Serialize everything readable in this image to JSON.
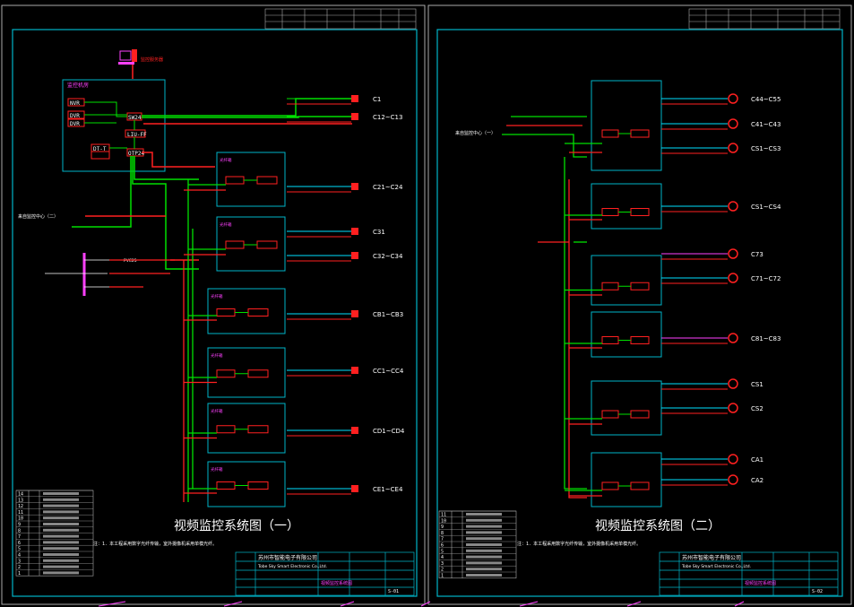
{
  "sheet1": {
    "title": "视频监控系统图（一）",
    "note": "注：1．本工程采用数字光纤传输，室外摄像机采用单模光纤。",
    "company_cn": "苏州市智能电子有限公司",
    "company_en": "Tobe Sky Smart Electronic Co.,Ltd.",
    "drawing_name": "视频监控系统图",
    "drawing_no": "S-01",
    "server_label": "监控服务器",
    "center_room": "监控机房",
    "center_items": [
      "NVR",
      "DVR",
      "DVR",
      "SW24",
      "LIU-FF",
      "DT-T",
      "OTP24"
    ],
    "cabinet_label": "光纤箱",
    "source_label": "来自监控中心（二）",
    "wall_label": "PVC25",
    "cam_groups": [
      {
        "id": "A",
        "labels": [
          "C1"
        ]
      },
      {
        "id": "B",
        "labels": [
          "C12~C13"
        ]
      },
      {
        "id": "C",
        "labels": [
          "C21~C24"
        ]
      },
      {
        "id": "D",
        "labels": [
          "C31"
        ]
      },
      {
        "id": "E",
        "labels": [
          "C32~C34"
        ]
      },
      {
        "id": "F",
        "labels": [
          "CB1~CB3"
        ]
      },
      {
        "id": "G",
        "labels": [
          "CC1~CC4"
        ]
      },
      {
        "id": "H",
        "labels": [
          "CD1~CD4"
        ]
      },
      {
        "id": "I",
        "labels": [
          "CE1~CE4"
        ]
      }
    ],
    "legend_rows": [
      "14",
      "13",
      "12",
      "11",
      "10",
      "9",
      "8",
      "7",
      "6",
      "5",
      "4",
      "3",
      "2",
      "1"
    ]
  },
  "sheet2": {
    "title": "视频监控系统图（二）",
    "note": "注：1．本工程采用数字光纤传输，室外摄像机采用单模光纤。",
    "company_cn": "苏州市智能电子有限公司",
    "company_en": "Tobe Sky Smart Electronic Co.,Ltd.",
    "drawing_name": "视频监控系统图",
    "drawing_no": "S-02",
    "source_label": "来自监控中心（一）",
    "cam_labels": [
      "C44~C55",
      "C41~C43",
      "CS1~CS3",
      "CS1~CS4",
      "C73",
      "C71~C72",
      "C81~C83",
      "CS1",
      "CS2",
      "CA1",
      "CA2"
    ],
    "legend_rows": [
      "11",
      "10",
      "9",
      "8",
      "7",
      "6",
      "5",
      "4",
      "3",
      "2",
      "1"
    ]
  },
  "colors": {
    "frame": "#00b4c8",
    "green": "#00e000",
    "red": "#ff2020",
    "magenta": "#ff40ff",
    "cyan": "#00e0ff",
    "white": "#ffffff",
    "yellow": "#ffff40"
  }
}
